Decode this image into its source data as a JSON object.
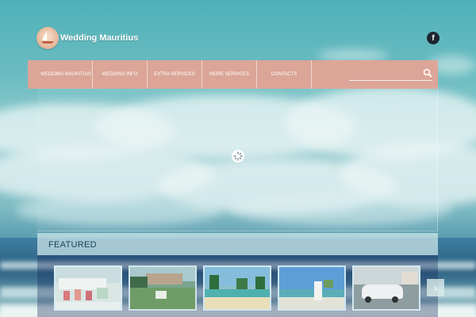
{
  "header": {
    "site_title": "Wedding Mauritius",
    "logo_icon": "sailboat-logo-icon",
    "social_icon": "facebook-icon",
    "social_label": "f"
  },
  "nav": {
    "items": [
      {
        "label": "WEDDING MAURITIUS"
      },
      {
        "label": "WEDDING INFO"
      },
      {
        "label": "EXTRA SERVICES"
      },
      {
        "label": "MORE SERVICES"
      },
      {
        "label": "CONTACTS"
      }
    ],
    "search_placeholder": "",
    "search_icon": "search-icon"
  },
  "slider": {
    "loader_icon": "loading-spinner-icon"
  },
  "featured": {
    "title": "FEATURED",
    "thumbnails": [
      {
        "name": "wedding-table-setup"
      },
      {
        "name": "beach-resort-lawn"
      },
      {
        "name": "palm-beach-resort"
      },
      {
        "name": "beach-wedding-arch"
      },
      {
        "name": "wedding-car"
      }
    ],
    "next_icon": "chevron-right-icon",
    "next_label": "›"
  },
  "colors": {
    "nav_background": "#e5a394",
    "featured_bar": "#d0e8ea",
    "accent_text": "#1e3e52"
  }
}
